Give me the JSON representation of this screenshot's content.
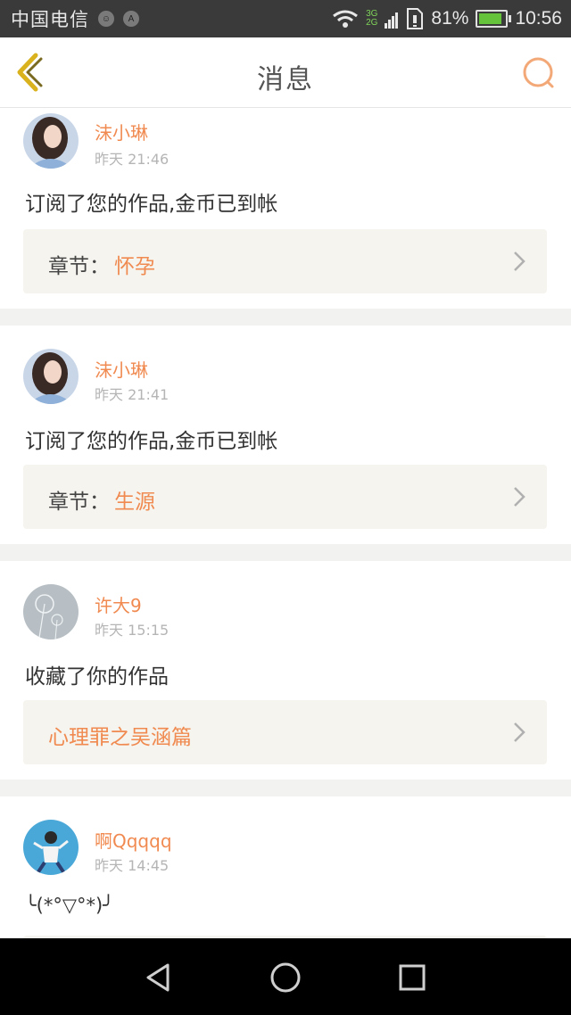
{
  "status_bar": {
    "carrier": "中国电信",
    "net_top": "3G",
    "net_bottom": "2G",
    "battery_percent": "81%",
    "time": "10:56"
  },
  "header": {
    "title": "消息"
  },
  "messages": [
    {
      "username": "沫小琳",
      "time": "昨天 21:46",
      "text": "订阅了您的作品,金币已到帐",
      "link_label": "章节：",
      "link_value": "怀孕"
    },
    {
      "username": "沫小琳",
      "time": "昨天 21:41",
      "text": "订阅了您的作品,金币已到帐",
      "link_label": "章节：",
      "link_value": "生源"
    },
    {
      "username": "许大9",
      "time": "昨天 15:15",
      "text": "收藏了你的作品",
      "link_value": "心理罪之吴涵篇"
    },
    {
      "username": "啊Qqqqq",
      "time": "昨天 14:45",
      "text": "╰(*°▽°*)╯"
    }
  ],
  "colors": {
    "accent": "#f08a50",
    "back_icon": "#d9b21e",
    "link_bg": "#f5f4ee",
    "status_bg": "#3a3a3a"
  }
}
